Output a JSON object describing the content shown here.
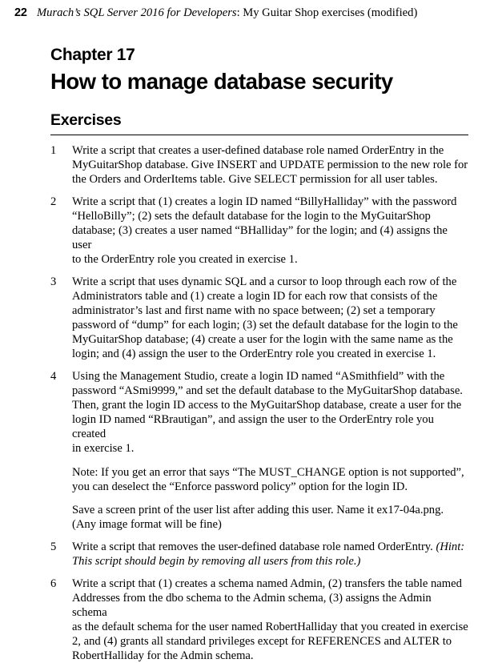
{
  "header": {
    "page_number": "22",
    "book_title": "Murach’s SQL Server 2016 for Developers",
    "header_rest": ": My Guitar Shop exercises (modified)"
  },
  "chapter": {
    "number_label": "Chapter 17",
    "title": "How to manage database security"
  },
  "section": {
    "heading": "Exercises"
  },
  "exercises": [
    {
      "number": "1",
      "paragraphs": [
        {
          "text": "Write a script that creates a user-defined database role named OrderEntry in the\nMyGuitarShop database. Give INSERT and UPDATE permission to the new role for\nthe Orders and OrderItems table. Give SELECT permission for all user tables."
        }
      ]
    },
    {
      "number": "2",
      "paragraphs": [
        {
          "text": "Write a script that (1) creates a login ID named “BillyHalliday” with the password\n“HelloBilly”; (2) sets the default database for the login to the MyGuitarShop\ndatabase; (3) creates a user named “BHalliday” for the login; and (4) assigns the user\nto the OrderEntry role you created in exercise 1."
        }
      ]
    },
    {
      "number": "3",
      "paragraphs": [
        {
          "text": "Write a script that uses dynamic SQL and a cursor to loop through each row of the\nAdministrators table and (1) create a login ID for each row that consists of the\nadministrator’s last and first name with no space between; (2) set a temporary\npassword of “dump” for each login; (3) set the default database for the login to the\nMyGuitarShop database; (4) create a user for the login with the same name as the\nlogin; and (4) assign the user to the OrderEntry role you created in exercise 1."
        }
      ]
    },
    {
      "number": "4",
      "paragraphs": [
        {
          "text": "Using the Management Studio, create a login ID named “ASmithfield” with the\npassword “ASmi9999,” and set the default database to the MyGuitarShop database.\nThen, grant the login ID access to the MyGuitarShop database, create a user for the\nlogin ID named “RBrautigan”, and assign the user to the OrderEntry role you created\nin exercise 1."
        },
        {
          "text": "Note: If you get an error that says “The MUST_CHANGE option is not supported”,\nyou can deselect the “Enforce password policy” option for the login ID."
        },
        {
          "text": "Save a screen print of the user list after adding this user.  Name it ex17-04a.png.\n(Any image format will be fine)"
        }
      ]
    },
    {
      "number": "5",
      "paragraphs": [
        {
          "text_before_italic": "Write a script that removes the user-defined database role named OrderEntry. ",
          "italic_text": "(Hint:\nThis script should begin by removing all users from this role.)"
        }
      ]
    },
    {
      "number": "6",
      "paragraphs": [
        {
          "text": "Write a script that (1) creates a schema named Admin, (2) transfers the table named\nAddresses from the dbo schema to the Admin schema, (3) assigns the Admin schema\nas the default schema for the user named RobertHalliday that you created in exercise\n2, and (4) grants all standard privileges except for REFERENCES and ALTER to\nRobertHalliday for the Admin schema."
        }
      ]
    }
  ]
}
